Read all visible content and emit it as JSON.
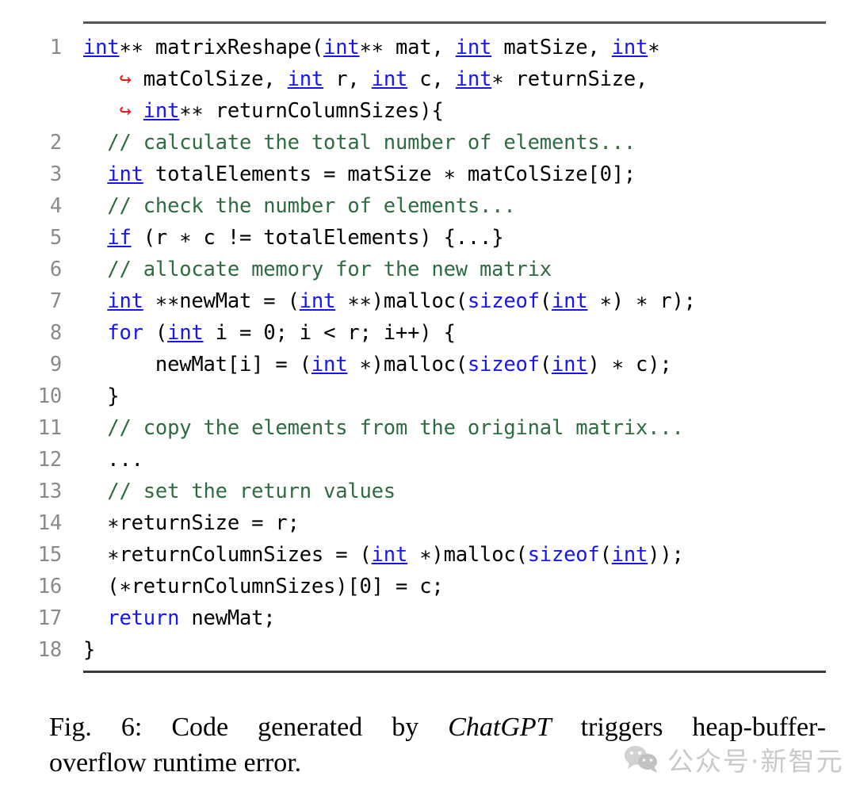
{
  "figure": {
    "rules": {
      "color": "#555555"
    },
    "line_number_color": "#8a8a8a",
    "syntax_colors": {
      "keyword": "#1414ff",
      "comment": "#2d6b40",
      "plain": "#000000",
      "continuation_arrow": "#e01b1b"
    },
    "code_lines": [
      {
        "num": "1",
        "segments": [
          {
            "t": "int",
            "c": "kwu"
          },
          {
            "t": "∗∗ matrixReshape(",
            "c": "op"
          },
          {
            "t": "int",
            "c": "kwu"
          },
          {
            "t": "∗∗ mat, ",
            "c": "op"
          },
          {
            "t": "int",
            "c": "kwu"
          },
          {
            "t": " matSize, ",
            "c": "op"
          },
          {
            "t": "int",
            "c": "kwu"
          },
          {
            "t": "∗",
            "c": "op"
          }
        ],
        "continuations": [
          [
            {
              "t": "↪",
              "c": "arrow"
            },
            {
              "t": " matColSize, ",
              "c": "op"
            },
            {
              "t": "int",
              "c": "kwu"
            },
            {
              "t": " r, ",
              "c": "op"
            },
            {
              "t": "int",
              "c": "kwu"
            },
            {
              "t": " c, ",
              "c": "op"
            },
            {
              "t": "int",
              "c": "kwu"
            },
            {
              "t": "∗ returnSize,",
              "c": "op"
            }
          ],
          [
            {
              "t": "↪",
              "c": "arrow"
            },
            {
              "t": " ",
              "c": "op"
            },
            {
              "t": "int",
              "c": "kwu"
            },
            {
              "t": "∗∗ returnColumnSizes){",
              "c": "op"
            }
          ]
        ]
      },
      {
        "num": "2",
        "segments": [
          {
            "t": "  // calculate the total number of elements...",
            "c": "cm"
          }
        ]
      },
      {
        "num": "3",
        "segments": [
          {
            "t": "  ",
            "c": "op"
          },
          {
            "t": "int",
            "c": "kwu"
          },
          {
            "t": " totalElements = matSize ∗ matColSize[0];",
            "c": "op"
          }
        ]
      },
      {
        "num": "4",
        "segments": [
          {
            "t": "  // check the number of elements...",
            "c": "cm"
          }
        ]
      },
      {
        "num": "5",
        "segments": [
          {
            "t": "  ",
            "c": "op"
          },
          {
            "t": "if",
            "c": "kwu"
          },
          {
            "t": " (r ∗ c != totalElements) {...}",
            "c": "op"
          }
        ]
      },
      {
        "num": "6",
        "segments": [
          {
            "t": "  // allocate memory for the new matrix",
            "c": "cm"
          }
        ]
      },
      {
        "num": "7",
        "segments": [
          {
            "t": "  ",
            "c": "op"
          },
          {
            "t": "int",
            "c": "kwu"
          },
          {
            "t": " ∗∗newMat = (",
            "c": "op"
          },
          {
            "t": "int",
            "c": "kwu"
          },
          {
            "t": " ∗∗)malloc(",
            "c": "op"
          },
          {
            "t": "sizeof",
            "c": "kw"
          },
          {
            "t": "(",
            "c": "op"
          },
          {
            "t": "int",
            "c": "kwu"
          },
          {
            "t": " ∗) ∗ r);",
            "c": "op"
          }
        ]
      },
      {
        "num": "8",
        "segments": [
          {
            "t": "  ",
            "c": "op"
          },
          {
            "t": "for",
            "c": "kw"
          },
          {
            "t": " (",
            "c": "op"
          },
          {
            "t": "int",
            "c": "kwu"
          },
          {
            "t": " i = 0; i < r; i++) {",
            "c": "op"
          }
        ]
      },
      {
        "num": "9",
        "segments": [
          {
            "t": "      newMat[i] = (",
            "c": "op"
          },
          {
            "t": "int",
            "c": "kwu"
          },
          {
            "t": " ∗)malloc(",
            "c": "op"
          },
          {
            "t": "sizeof",
            "c": "kw"
          },
          {
            "t": "(",
            "c": "op"
          },
          {
            "t": "int",
            "c": "kwu"
          },
          {
            "t": ") ∗ c);",
            "c": "op"
          }
        ]
      },
      {
        "num": "10",
        "segments": [
          {
            "t": "  }",
            "c": "op"
          }
        ]
      },
      {
        "num": "11",
        "segments": [
          {
            "t": "  // copy the elements from the original matrix...",
            "c": "cm"
          }
        ]
      },
      {
        "num": "12",
        "segments": [
          {
            "t": "  ...",
            "c": "op"
          }
        ]
      },
      {
        "num": "13",
        "segments": [
          {
            "t": "  // set the return values",
            "c": "cm"
          }
        ]
      },
      {
        "num": "14",
        "segments": [
          {
            "t": "  ∗returnSize = r;",
            "c": "op"
          }
        ]
      },
      {
        "num": "15",
        "segments": [
          {
            "t": "  ∗returnColumnSizes = (",
            "c": "op"
          },
          {
            "t": "int",
            "c": "kwu"
          },
          {
            "t": " ∗)malloc(",
            "c": "op"
          },
          {
            "t": "sizeof",
            "c": "kw"
          },
          {
            "t": "(",
            "c": "op"
          },
          {
            "t": "int",
            "c": "kwu"
          },
          {
            "t": "));",
            "c": "op"
          }
        ]
      },
      {
        "num": "16",
        "segments": [
          {
            "t": "  (∗returnColumnSizes)[0] = c;",
            "c": "op"
          }
        ]
      },
      {
        "num": "17",
        "segments": [
          {
            "t": "  ",
            "c": "op"
          },
          {
            "t": "return",
            "c": "kw"
          },
          {
            "t": " newMat;",
            "c": "op"
          }
        ]
      },
      {
        "num": "18",
        "segments": [
          {
            "t": "}",
            "c": "op"
          }
        ]
      }
    ]
  },
  "caption": {
    "label": "Fig. 6:",
    "line1_before_italic": "Code generated by",
    "italic_term": "ChatGPT",
    "line1_after_italic": "triggers heap-buffer-",
    "line2": "overflow runtime error.",
    "full_text": "Fig. 6: Code generated by ChatGPT triggers heap-buffer-overflow runtime error."
  },
  "watermark": {
    "icon": "wechat-icon",
    "text": "公众号·新智元",
    "color": "#c9c9c9"
  }
}
